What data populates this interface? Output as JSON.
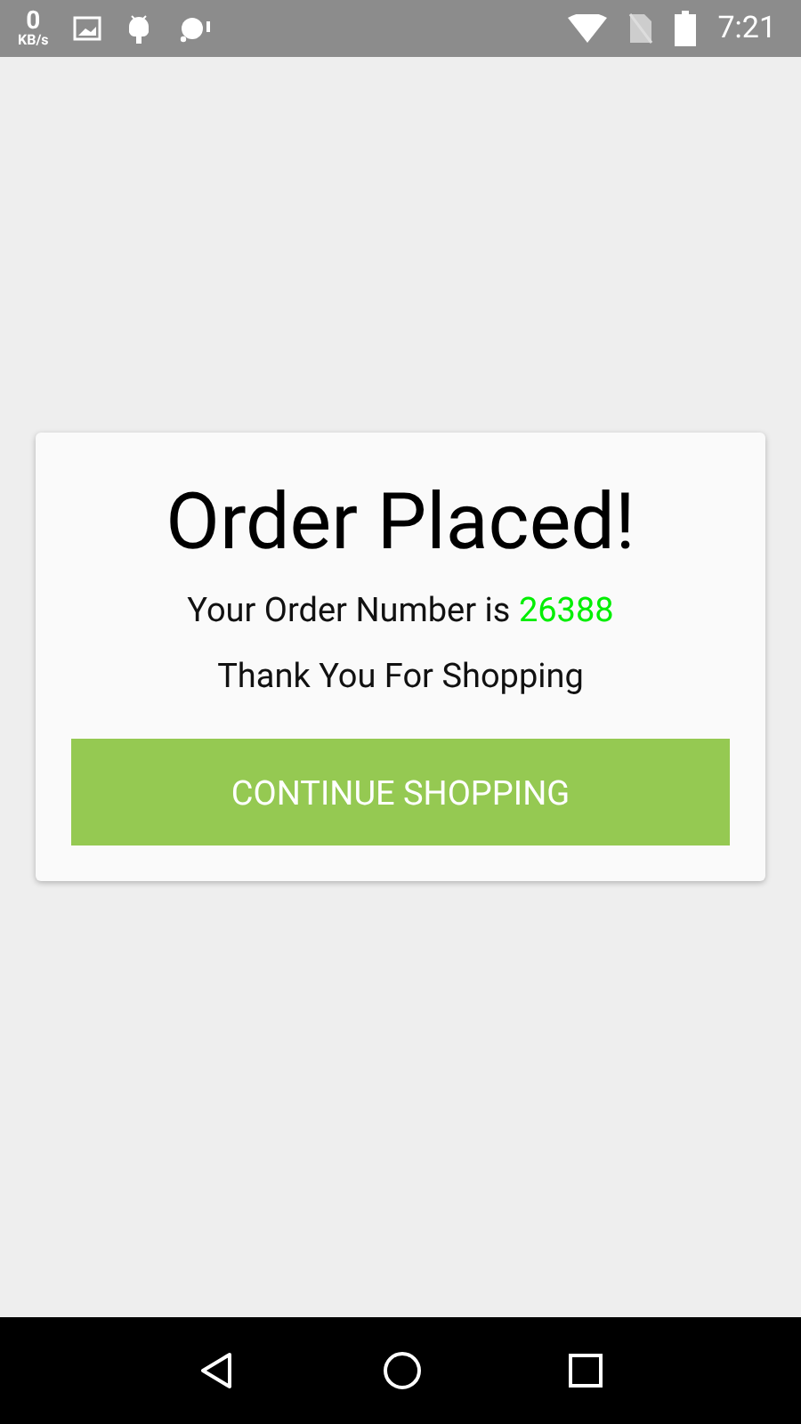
{
  "status_bar": {
    "speed_value": "0",
    "speed_unit": "KB/s",
    "time": "7:21"
  },
  "dialog": {
    "title": "Order Placed!",
    "order_label": "Your Order Number is",
    "order_number": "26388",
    "thanks": "Thank You For Shopping",
    "button": "CONTINUE SHOPPING"
  }
}
